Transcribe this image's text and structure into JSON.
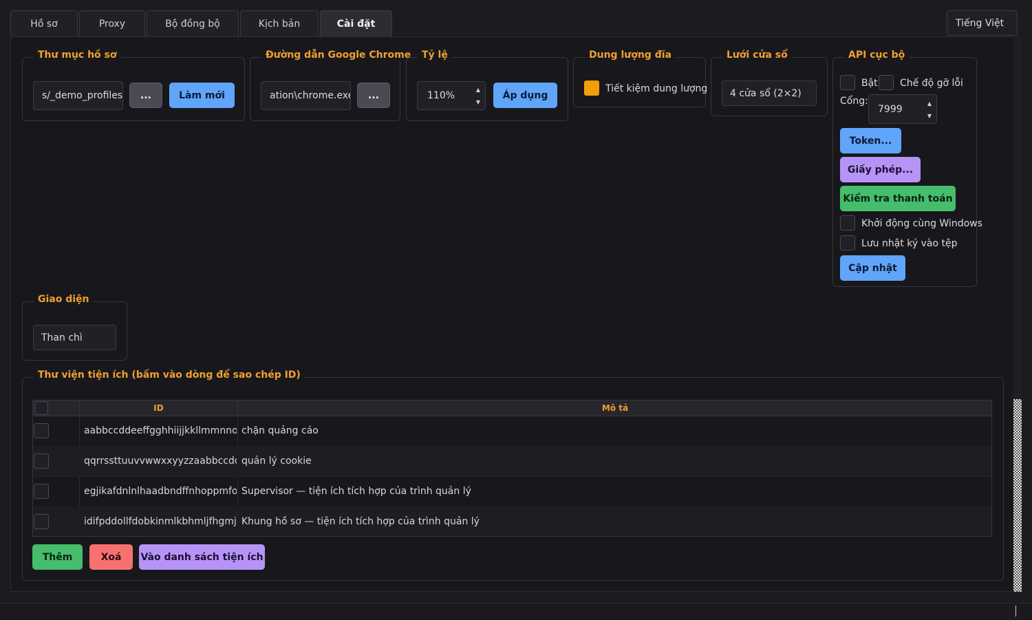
{
  "tabs": [
    "Hồ sơ",
    "Proxy",
    "Bộ đồng bộ",
    "Kịch bản",
    "Cài đặt"
  ],
  "active_tab": "Cài đặt",
  "language": "Tiếng Việt",
  "profiles_folder": {
    "legend": "Thư mục hồ sơ",
    "value": "s/_demo_profiles",
    "browse_label": "...",
    "refresh_label": "Làm mới"
  },
  "chrome_path": {
    "legend": "Đường dẫn Google Chrome",
    "value": "ation\\chrome.exe",
    "browse_label": "..."
  },
  "scale": {
    "legend": "Tỷ lệ",
    "value": "110%",
    "apply_label": "Áp dụng"
  },
  "disk": {
    "legend": "Dung lượng đĩa",
    "save_space_label": "Tiết kiệm dung lượng",
    "save_space_checked": true,
    "accent_color": "#f59e0b"
  },
  "grid": {
    "legend": "Lưới cửa sổ",
    "value": "4 cửa sổ (2×2)"
  },
  "api": {
    "legend": "API cục bộ",
    "enable_label": "Bật",
    "debug_label": "Chế độ gỡ lỗi",
    "port_label": "Cổng:",
    "port_value": "7999",
    "token_label": "Token...",
    "license_label": "Giấy phép...",
    "payment_label": "Kiểm tra thanh toán",
    "startup_label": "Khởi động cùng Windows",
    "log_label": "Lưu nhật ký vào tệp",
    "update_label": "Cập nhật"
  },
  "theme": {
    "legend": "Giao diện",
    "value": "Than chì"
  },
  "extensions": {
    "legend": "Thư viện tiện ích (bấm vào dòng để sao chép ID)",
    "columns": [
      "ID",
      "Mô tả"
    ],
    "rows": [
      {
        "id": "aabbccddeeffgghhiijjkkllmmnnoopp",
        "desc": "chặn quảng cáo"
      },
      {
        "id": "qqrrssttuuvvwwxxyyzzaabbccddeeff",
        "desc": "quản lý cookie"
      },
      {
        "id": "egjikafdnlnlhaadbndffnhoppmfofej",
        "desc": "Supervisor — tiện ích tích hợp của trình quản lý"
      },
      {
        "id": "idifpddollfdobkinmlkbhmljfhgmjki",
        "desc": "Khung hồ sơ — tiện ích tích hợp của trình quản lý"
      }
    ],
    "add_label": "Thêm",
    "delete_label": "Xoá",
    "store_label": "Vào danh sách tiện ích"
  }
}
